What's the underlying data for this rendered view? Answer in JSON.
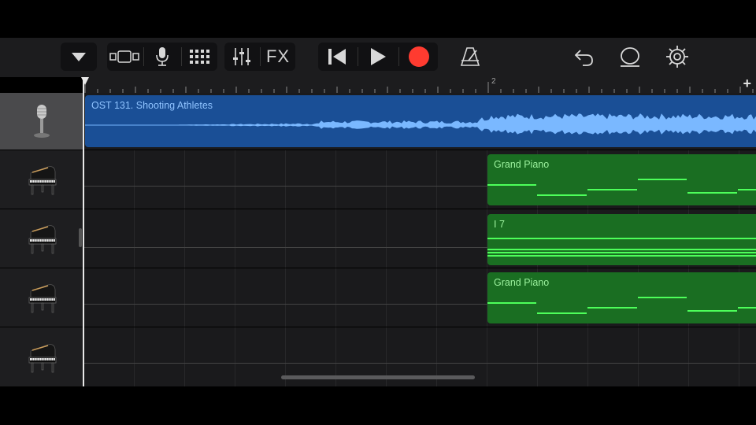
{
  "toolbar": {
    "browser_icon": "triangle-down-icon",
    "view_icon": "view-toggle-icon",
    "instrument_icon": "microphone-icon",
    "tracks_icon": "grid-icon",
    "mixer_icon": "sliders-icon",
    "fx_label": "FX",
    "rewind_icon": "go-to-beginning-icon",
    "play_icon": "play-icon",
    "record_icon": "record-icon",
    "record_color": "#ff3b30",
    "metronome_icon": "metronome-icon",
    "undo_icon": "undo-icon",
    "loops_icon": "loop-icon",
    "settings_icon": "gear-icon"
  },
  "ruler": {
    "bar_number": "2",
    "add_label": "+"
  },
  "tracks": [
    {
      "icon": "microphone-icon",
      "selected": true
    },
    {
      "icon": "grand-piano-icon",
      "selected": false
    },
    {
      "icon": "grand-piano-icon",
      "selected": false
    },
    {
      "icon": "grand-piano-icon",
      "selected": false
    },
    {
      "icon": "grand-piano-icon",
      "selected": false
    }
  ],
  "regions": [
    {
      "track": 0,
      "type": "audio",
      "name": "OST 131. Shooting Athletes",
      "color": "#1a4f96"
    },
    {
      "track": 1,
      "type": "midi",
      "name": "Grand Piano",
      "color": "#1a6e22"
    },
    {
      "track": 2,
      "type": "midi",
      "name": "I 7",
      "color": "#1a6e22"
    },
    {
      "track": 3,
      "type": "midi",
      "name": "Grand Piano",
      "color": "#1a6e22"
    }
  ]
}
